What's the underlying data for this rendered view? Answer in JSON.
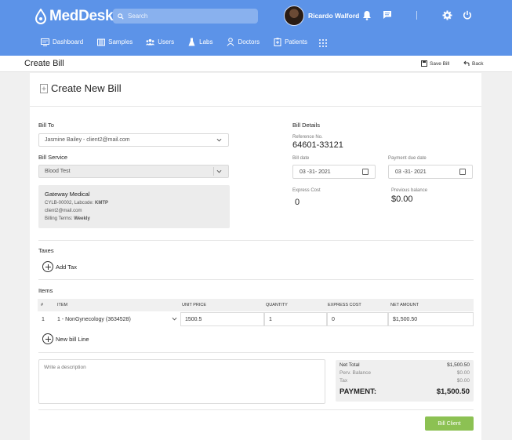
{
  "app": {
    "name": "MedDesk"
  },
  "search": {
    "placeholder": "Search"
  },
  "user": {
    "name": "Ricardo Walford"
  },
  "nav": {
    "items": [
      {
        "label": "Dashboard",
        "icon": "monitor-icon"
      },
      {
        "label": "Samples",
        "icon": "samples-icon"
      },
      {
        "label": "Users",
        "icon": "users-icon"
      },
      {
        "label": "Labs",
        "icon": "flask-icon"
      },
      {
        "label": "Doctors",
        "icon": "doctor-icon"
      },
      {
        "label": "Patients",
        "icon": "patients-icon"
      }
    ]
  },
  "page": {
    "title": "Create Bill",
    "save_label": "Save Bill",
    "back_label": "Back"
  },
  "form": {
    "card_title": "Create New Bill",
    "bill_to_label": "Bill To",
    "bill_to_value": "Jasmine Bailey - client2@mail.com",
    "bill_service_label": "Bill Service",
    "bill_service_value": "Blood Test",
    "client": {
      "name": "Gateway Medical",
      "line1_prefix": "CYLB-00002, Labcode: ",
      "labcode": "KMTP",
      "email": "client2@mail.com",
      "terms_prefix": "Billing Terms: ",
      "terms": "Weekly"
    },
    "details": {
      "title": "Bill Details",
      "reference_label": "Reference No.",
      "reference_value": "64601-33121",
      "bill_date_label": "Bill date",
      "bill_date_value": "03 -31- 2021",
      "due_date_label": "Payment due date",
      "due_date_value": "03 -31- 2021",
      "express_cost_label": "Express Cost",
      "express_cost_value": "0",
      "previous_balance_label": "Previous balance",
      "previous_balance_value": "$0.00"
    },
    "taxes_label": "Taxes",
    "add_tax_label": "Add Tax",
    "items_label": "Items",
    "items_headers": [
      "#",
      "ITEM",
      "UNIT PRICE",
      "QUANTITY",
      "EXPRESS COST",
      "NET AMOUNT"
    ],
    "items": [
      {
        "num": "1",
        "item": "1 - NonGynecology (3634528)",
        "unit_price": "1500.5",
        "quantity": "1",
        "express_cost": "0",
        "net_amount": "$1,500.50"
      }
    ],
    "new_line_label": "New bill Line",
    "description_placeholder": "Write a description",
    "totals": {
      "net_total_label": "Net Total",
      "net_total_value": "$1,500.50",
      "prev_balance_label": "Perv. Balance",
      "prev_balance_value": "$0.00",
      "tax_label": "Tax",
      "tax_value": "$0.00",
      "payment_label": "PAYMENT:",
      "payment_value": "$1,500.50"
    },
    "bill_client_label": "Bill Client"
  },
  "colors": {
    "header": "#5c93e8",
    "bill_button": "#8cc153"
  }
}
